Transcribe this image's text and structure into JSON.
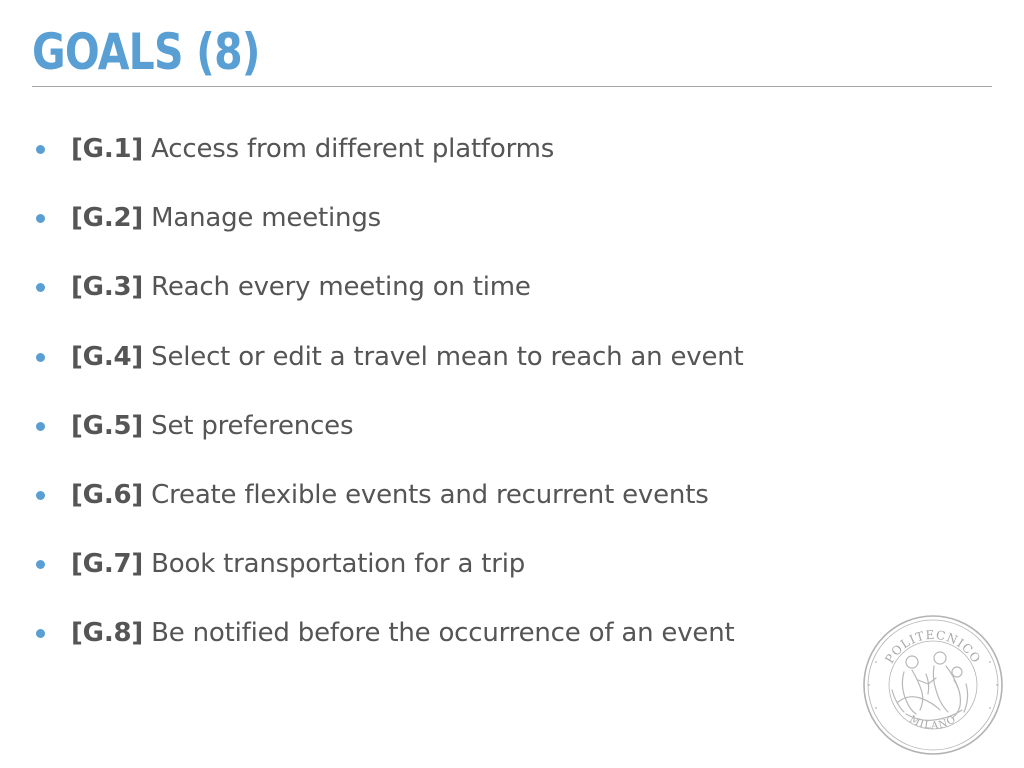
{
  "slide": {
    "title": "GOALS  (8)"
  },
  "goals": [
    {
      "code": "[G.1]",
      "text": "Access from different platforms"
    },
    {
      "code": "[G.2]",
      "text": "Manage meetings"
    },
    {
      "code": "[G.3]",
      "text": "Reach every meeting on time"
    },
    {
      "code": "[G.4]",
      "text": "Select or edit a travel mean to reach an event"
    },
    {
      "code": "[G.5]",
      "text": "Set preferences"
    },
    {
      "code": "[G.6]",
      "text": "Create flexible events and recurrent events"
    },
    {
      "code": "[G.7]",
      "text": "Book transportation for a trip"
    },
    {
      "code": "[G.8]",
      "text": "Be notified before the occurrence of an event"
    }
  ],
  "logo": {
    "top_text": "POLITECNICO",
    "bottom_text": "MILANO"
  },
  "colors": {
    "accent": "#5a9fd4",
    "text": "#555555",
    "rule": "#a6a6a6",
    "seal": "#b3b3b3"
  }
}
